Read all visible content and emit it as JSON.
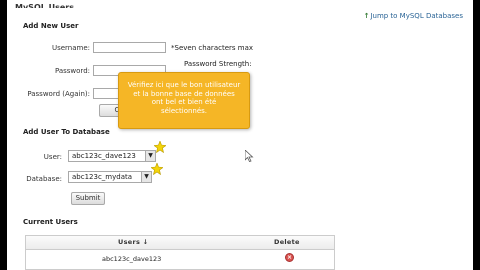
{
  "page": {
    "section_title": "MySQL Users",
    "jump_link": "Jump to MySQL Databases"
  },
  "add_user": {
    "heading": "Add New User",
    "username_label": "Username:",
    "username_value": "",
    "username_note": "*Seven characters max",
    "password_label": "Password:",
    "password_value": "",
    "strength_label": "Password Strength:",
    "password_again_label": "Password (Again):",
    "password_again_value": "",
    "create_button": "Create User"
  },
  "add_user_to_db": {
    "heading": "Add User To Database",
    "user_label": "User:",
    "user_selected": "abc123c_dave123",
    "database_label": "Database:",
    "database_selected": "abc123c_mydata",
    "submit_button": "Submit"
  },
  "tooltip": {
    "lines": [
      "Vérifiez ici que le bon utilisateur",
      "et la bonne base de données",
      "ont bel et bien été",
      "sélectionnés."
    ]
  },
  "current_users": {
    "heading": "Current Users",
    "columns": [
      "Users ↓",
      "Delete"
    ],
    "rows": [
      {
        "user": "abc123c_dave123"
      }
    ]
  },
  "colors": {
    "tooltip_bg": "#f5b626",
    "link": "#2a6496",
    "delete_icon": "#d9534f"
  }
}
